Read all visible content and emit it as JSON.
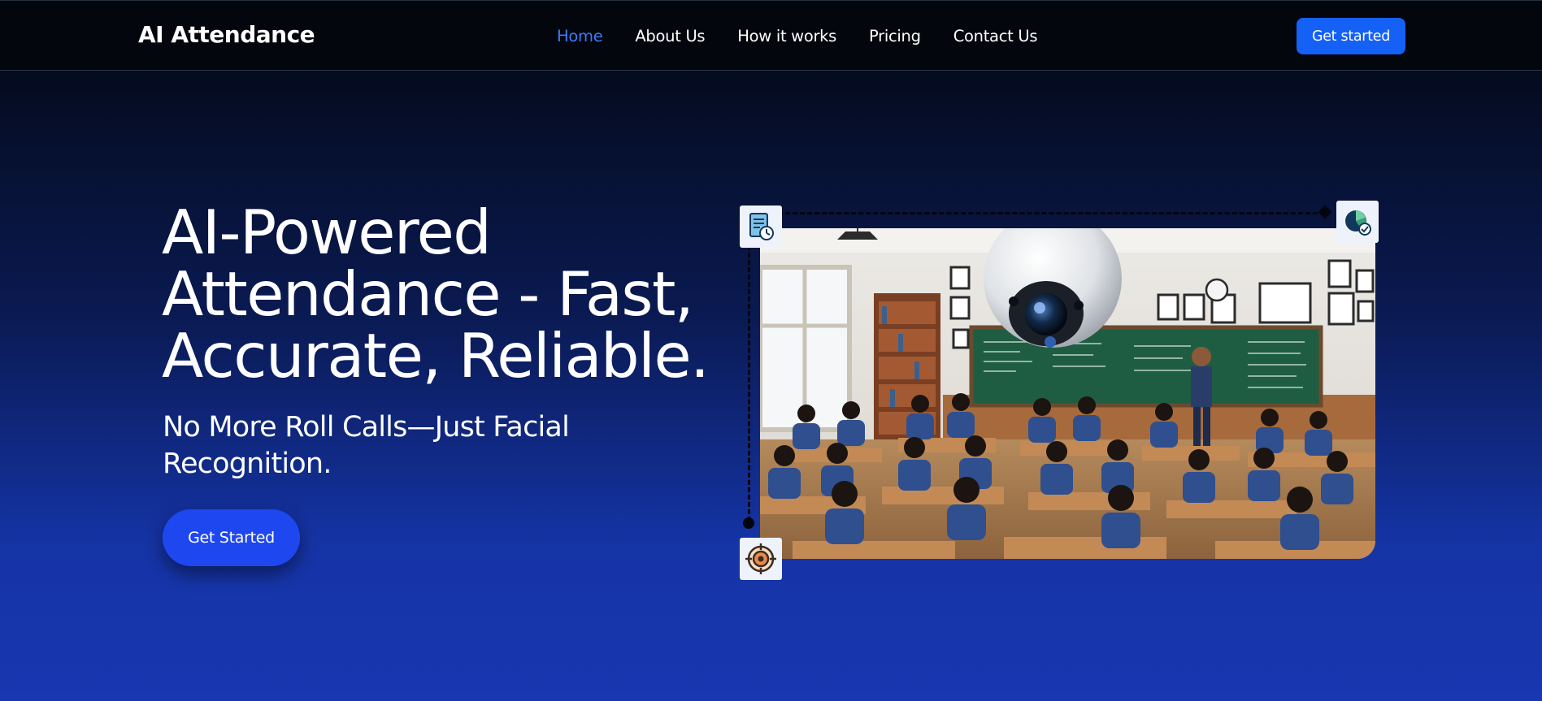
{
  "brand": {
    "name": "AI Attendance"
  },
  "nav": {
    "items": [
      {
        "label": "Home",
        "active": true
      },
      {
        "label": "About Us",
        "active": false
      },
      {
        "label": "How it works",
        "active": false
      },
      {
        "label": "Pricing",
        "active": false
      },
      {
        "label": "Contact Us",
        "active": false
      }
    ],
    "cta_label": "Get started"
  },
  "hero": {
    "title": "AI-Powered Attendance - Fast, Accurate, Reliable.",
    "subtitle": "No More Roll Calls—Just Facial Recognition.",
    "cta_label": "Get Started"
  },
  "illustration": {
    "badges": [
      "document-clock-icon",
      "chart-check-icon",
      "target-icon"
    ]
  },
  "colors": {
    "accent": "#1560f5",
    "nav_active": "#3b7bff",
    "hero_button": "#1e47f0",
    "nav_background": "#03060c"
  }
}
